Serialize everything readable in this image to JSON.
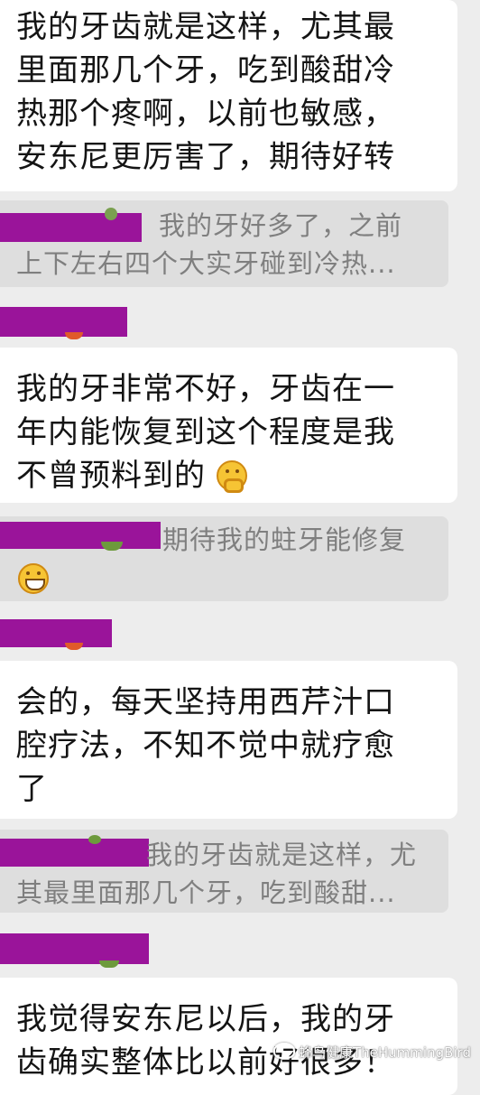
{
  "messages": [
    {
      "lines": [
        "我的牙齿就是这样，尤其最",
        "里面那几个牙，吃到酸甜冷",
        "热那个疼啊，以前也敏感，",
        "安东尼更厉害了，期待好转"
      ]
    },
    {
      "lines": [
        "我的牙非常不好，牙齿在一",
        "年内能恢复到这个程度是我",
        "不曾预料到的"
      ],
      "emoji": "thinking-face"
    },
    {
      "lines": [
        "会的，每天坚持用西芹汁口",
        "腔疗法，不知不觉中就疗愈",
        "了"
      ]
    },
    {
      "lines": [
        "我觉得安东尼以后，我的牙",
        "齿确实整体比以前好很多！"
      ]
    }
  ],
  "quotes": [
    {
      "line1": "我的牙好多了，之前",
      "line2": "上下左右四个大实牙碰到冷热..."
    },
    {
      "line1": "期待我的蛀牙能修复",
      "emoji": "grinning-face"
    },
    {
      "line1": "我的牙齿就是这样，尤",
      "line2": "其最里面那几个牙，吃到酸甜..."
    }
  ],
  "watermark": {
    "text": "蜂鸟健康TheHummingBird"
  },
  "colors": {
    "background": "#ededed",
    "bubble": "#ffffff",
    "quote_bubble": "#dedede",
    "redaction": "#9a149a"
  }
}
